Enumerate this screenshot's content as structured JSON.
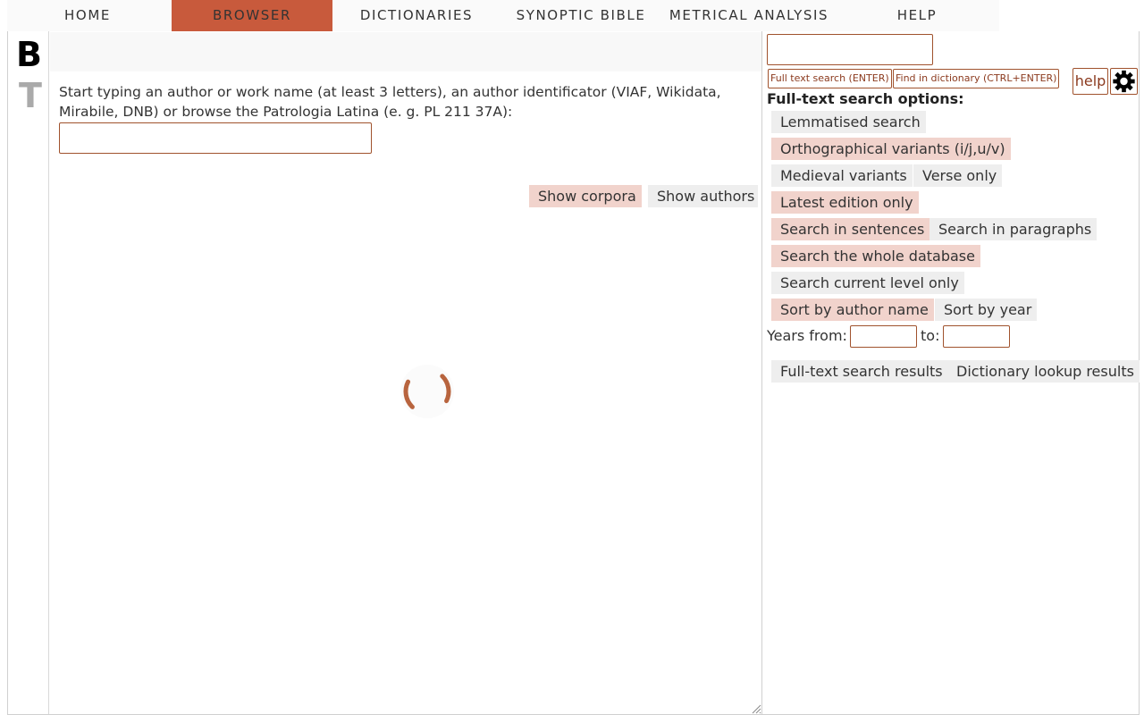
{
  "nav": {
    "items": [
      {
        "label": "HOME"
      },
      {
        "label": "BROWSER",
        "active": true
      },
      {
        "label": "DICTIONARIES"
      },
      {
        "label": "SYNOPTIC BIBLE"
      },
      {
        "label": "METRICAL ANALYSIS"
      },
      {
        "label": "HELP"
      }
    ]
  },
  "logo": {
    "letter_top": "B",
    "letter_bottom": "T"
  },
  "browser": {
    "intro": "Start typing an author or work name (at least 3 letters), an author identificator (VIAF, Wikidata, Mirabile, DNB) or browse the Patrologia Latina (e. g. PL 211 37A):",
    "author_input_value": "",
    "show_corpora": "Show corpora",
    "show_authors": "Show authors",
    "loading_icon": "spinner-icon"
  },
  "search": {
    "input_value": "",
    "full_text_btn": "Full text search (ENTER)",
    "dictionary_btn": "Find in dictionary (CTRL+ENTER)",
    "help_btn": "help",
    "settings_icon": "gear-icon",
    "options_title": "Full-text search options:",
    "options": {
      "lemmatised": {
        "label": "Lemmatised search",
        "on": false
      },
      "orthographical": {
        "label": "Orthographical variants (i/j,u/v)",
        "on": true
      },
      "medieval": {
        "label": "Medieval variants",
        "on": false
      },
      "verse": {
        "label": "Verse only",
        "on": false
      },
      "latest": {
        "label": "Latest edition only",
        "on": true
      },
      "sentences": {
        "label": "Search in sentences",
        "on": true
      },
      "paragraphs": {
        "label": "Search in paragraphs",
        "on": false
      },
      "whole_db": {
        "label": "Search the whole database",
        "on": true
      },
      "current_level": {
        "label": "Search current level only",
        "on": false
      },
      "sort_author": {
        "label": "Sort by author name",
        "on": true
      },
      "sort_year": {
        "label": "Sort by year",
        "on": false
      }
    },
    "years_from_label": "Years from:",
    "years_to_label": "to:",
    "year_from_value": "",
    "year_to_value": "",
    "results_fulltext": "Full-text search results",
    "results_dictionary": "Dictionary lookup results"
  },
  "colors": {
    "accent": "#c85a3c",
    "toggle_on": "#f1d3cc",
    "toggle_off": "#eeeeee",
    "border": "#a0522d"
  }
}
